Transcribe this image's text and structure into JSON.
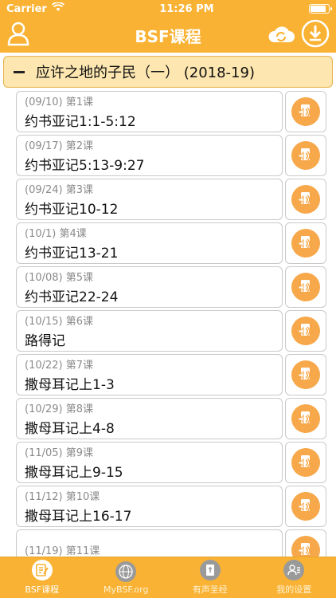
{
  "status": {
    "carrier": "Carrier",
    "time": "11:26 PM",
    "battery_fraction": 0.9
  },
  "nav": {
    "title": "BSF课程"
  },
  "section": {
    "title": "应许之地的子民（一） (2018-19)"
  },
  "lessons": [
    {
      "meta": "(09/10) 第1课",
      "title": "约书亚记1:1-5:12"
    },
    {
      "meta": "(09/17) 第2课",
      "title": "约书亚记5:13-9:27"
    },
    {
      "meta": "(09/24) 第3课",
      "title": "约书亚记10-12"
    },
    {
      "meta": "(10/1) 第4课",
      "title": "约书亚记13-21"
    },
    {
      "meta": "(10/08) 第5课",
      "title": "约书亚记22-24"
    },
    {
      "meta": "(10/15) 第6课",
      "title": "路得记"
    },
    {
      "meta": "(10/22) 第7课",
      "title": "撒母耳记上1-3"
    },
    {
      "meta": "(10/29) 第8课",
      "title": "撒母耳记上4-8"
    },
    {
      "meta": "(11/05) 第9课",
      "title": "撒母耳记上9-15"
    },
    {
      "meta": "(11/12) 第10课",
      "title": "撒母耳记上16-17"
    },
    {
      "meta": "(11/19) 第11课",
      "title": ""
    }
  ],
  "tabs": [
    {
      "label": "BSF课程",
      "icon": "edit-document-icon",
      "active": true
    },
    {
      "label": "MyBSF.org",
      "icon": "globe-www-icon",
      "active": false
    },
    {
      "label": "有声圣经",
      "icon": "audio-bible-icon",
      "active": false
    },
    {
      "label": "我的设置",
      "icon": "user-settings-icon",
      "active": false
    }
  ],
  "colors": {
    "accent": "#f9b233",
    "section_bg": "#fde6b0",
    "audio_button": "#f7a84a"
  }
}
